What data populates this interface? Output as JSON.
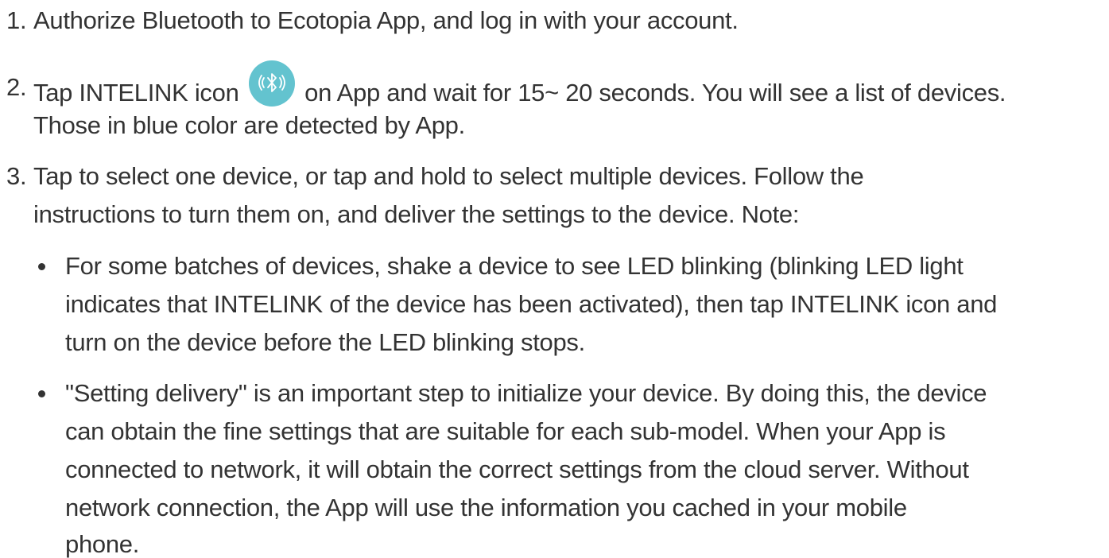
{
  "steps": [
    {
      "number": "1.",
      "lines": [
        "Authorize Bluetooth to Ecotopia App, and log in with your account."
      ]
    },
    {
      "number": "2.",
      "line1_before_icon": "Tap INTELINK icon",
      "icon": "bluetooth-icon",
      "line1_after_icon": "on App and wait for 15~ 20 seconds. You will see a list of devices.",
      "lines": [
        "Those in blue color are detected by App."
      ]
    },
    {
      "number": "3.",
      "lines": [
        "Tap to select one device, or tap and hold to select multiple devices. Follow the",
        "instructions to turn them on, and deliver the settings to the device. Note:"
      ],
      "bullets": [
        {
          "lines": [
            "For some batches of devices, shake a device to see LED blinking (blinking LED light",
            "indicates that INTELINK of the device has been activated), then tap INTELINK icon and",
            "turn on the device before the LED blinking stops."
          ]
        },
        {
          "lines": [
            "\"Setting delivery\" is an important step to initialize your device. By doing this, the device",
            "can obtain the fine settings that are suitable for each sub-model. When your App is",
            "connected to network, it will obtain the correct settings from the cloud server. Without",
            "network connection, the App will use the information you cached in your mobile",
            "phone."
          ]
        }
      ]
    }
  ],
  "colors": {
    "text": "#333333",
    "icon_bg": "#63c3cf",
    "icon_fg": "#ffffff"
  }
}
